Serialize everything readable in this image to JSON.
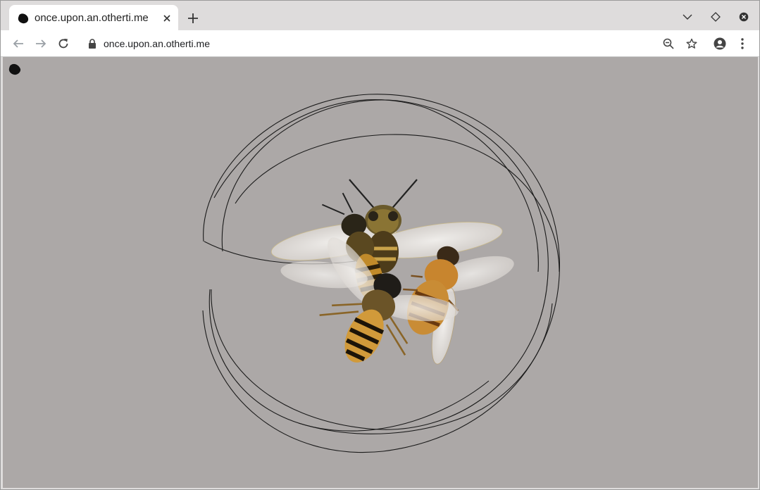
{
  "browser": {
    "tab": {
      "title": "once.upon.an.otherti.me",
      "favicon": "blob-icon"
    },
    "address_bar": {
      "url": "once.upon.an.otherti.me",
      "secure": true
    },
    "toolbar_icons": [
      "back-icon",
      "forward-icon",
      "reload-icon",
      "lock-icon",
      "zoom-out-icon",
      "bookmark-star-icon",
      "profile-icon",
      "menu-icon"
    ],
    "window_controls": [
      "tab-search-icon",
      "restore-icon",
      "close-window-icon"
    ]
  },
  "page": {
    "background": "#aca8a7",
    "logo": "blob-icon",
    "artwork": {
      "subject": "four honeybees",
      "stroke_color": "#1a1a1a"
    }
  }
}
